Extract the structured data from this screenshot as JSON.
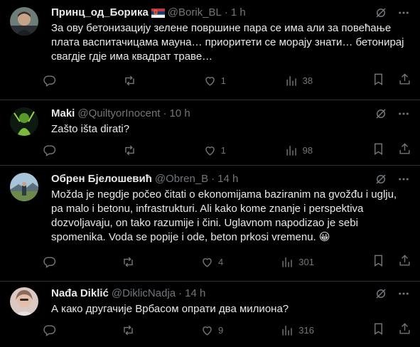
{
  "tweets": [
    {
      "name": "Принц_од_Борика",
      "has_flag": true,
      "handle": "@Borik_BL",
      "time": "1 h",
      "text": "За ову бетонизацију зелене површине пара се има али за повећање плата васпитачицама мауна… приоритети се морају знати… бетонирај свагдје гдје има квадрат траве…",
      "replies": "",
      "retweets": "",
      "likes": "1",
      "views": "38"
    },
    {
      "name": "Maki",
      "has_flag": false,
      "handle": "@QuiltyorInocent",
      "time": "10 h",
      "text": "Zašto išta dirati?",
      "replies": "",
      "retweets": "",
      "likes": "1",
      "views": "98"
    },
    {
      "name": "Обрен Бјелошевић",
      "has_flag": false,
      "handle": "@Obren_B",
      "time": "14 h",
      "text": "Možda je negdje počeo čitati o ekonomijama baziranim na gvožđu i uglju, pa malo i betonu, infrastrukturi. Ali kako kome znanje i perspektiva dozvoljavaju, on tako razumije i čini. Uglavnom napodizao je sebi spomenika. Voda se popije i ode, beton prkosi vremenu. 😀",
      "replies": "",
      "retweets": "",
      "likes": "4",
      "views": "301"
    },
    {
      "name": "Nađa Diklić",
      "has_flag": false,
      "handle": "@DiklicNadja",
      "time": "14 h",
      "text": "А како другачије Врбасом опрати два милиона?",
      "replies": "",
      "retweets": "",
      "likes": "9",
      "views": "316"
    }
  ],
  "colors": {
    "background": "#000000",
    "text": "#e7e9ea",
    "muted": "#71767b",
    "border": "#2f3336"
  },
  "icons": {
    "reply": "reply-icon",
    "retweet": "retweet-icon",
    "like": "heart-icon",
    "views": "views-icon",
    "bookmark": "bookmark-icon",
    "share": "share-icon",
    "grok": "grok-icon",
    "more": "more-icon"
  }
}
